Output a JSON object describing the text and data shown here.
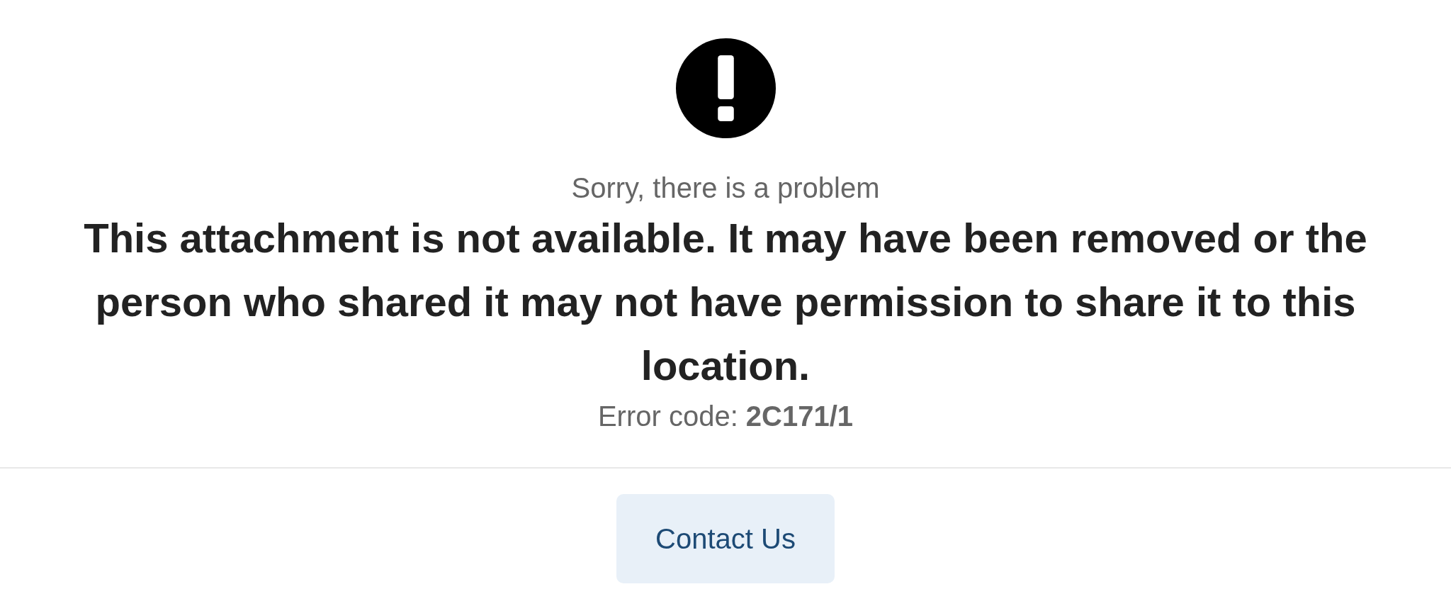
{
  "error": {
    "subtitle": "Sorry, there is a problem",
    "message": "This attachment is not available. It may have been removed or the person who shared it may not have permission to share it to this location.",
    "code": "Error code: **2C171/1**"
  },
  "button": {
    "label": "Contact Us"
  }
}
